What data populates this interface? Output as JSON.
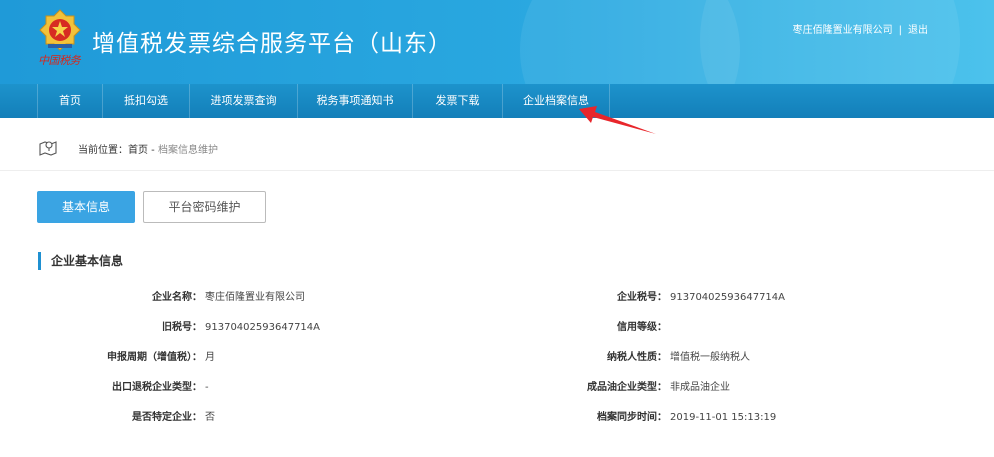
{
  "header": {
    "title": "增值税发票综合服务平台（山东）",
    "brand_script": "中国税务",
    "company": "枣庄佰隆置业有限公司",
    "separator": "|",
    "logout": "退出"
  },
  "nav": {
    "items": [
      {
        "label": "首页"
      },
      {
        "label": "抵扣勾选"
      },
      {
        "label": "进项发票查询"
      },
      {
        "label": "税务事项通知书"
      },
      {
        "label": "发票下载"
      },
      {
        "label": "企业档案信息"
      }
    ]
  },
  "breadcrumb": {
    "prefix": "当前位置：首页 - ",
    "current": "档案信息维护"
  },
  "tabs": {
    "basic": "基本信息",
    "password": "平台密码维护"
  },
  "section": {
    "title": "企业基本信息"
  },
  "info": {
    "left": [
      {
        "label": "企业名称：",
        "value": "枣庄佰隆置业有限公司"
      },
      {
        "label": "旧税号：",
        "value": "91370402593647714A"
      },
      {
        "label": "申报周期（增值税）：",
        "value": "月"
      },
      {
        "label": "出口退税企业类型：",
        "value": "-"
      },
      {
        "label": "是否特定企业：",
        "value": "否"
      }
    ],
    "right": [
      {
        "label": "企业税号：",
        "value": "91370402593647714A"
      },
      {
        "label": "信用等级：",
        "value": ""
      },
      {
        "label": "纳税人性质：",
        "value": "增值税一般纳税人"
      },
      {
        "label": "成品油企业类型：",
        "value": "非成品油企业"
      },
      {
        "label": "档案同步时间：",
        "value": "2019-11-01 15:13:19"
      }
    ]
  },
  "colors": {
    "header": "#2aa8e0",
    "nav": "#1783bd",
    "accent": "#3aa4e3",
    "annotation_arrow": "#e8262b"
  },
  "icons": {
    "emblem": "tax-emblem-icon",
    "location": "map-location-icon"
  }
}
